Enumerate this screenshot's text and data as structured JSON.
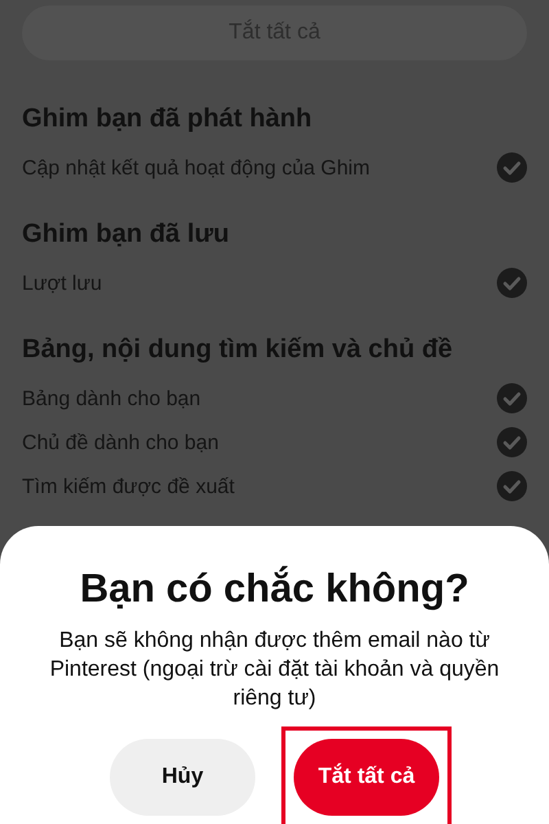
{
  "top_button": {
    "label": "Tắt tất cả"
  },
  "sections": [
    {
      "title": "Ghim bạn đã phát hành",
      "items": [
        {
          "label": "Cập nhật kết quả hoạt động của Ghim",
          "checked": true
        }
      ]
    },
    {
      "title": "Ghim bạn đã lưu",
      "items": [
        {
          "label": "Lượt lưu",
          "checked": true
        }
      ]
    },
    {
      "title": "Bảng, nội dung tìm kiếm và chủ đề",
      "items": [
        {
          "label": "Bảng dành cho bạn",
          "checked": true
        },
        {
          "label": "Chủ đề dành cho bạn",
          "checked": true
        },
        {
          "label": "Tìm kiếm được đề xuất",
          "checked": true
        }
      ]
    }
  ],
  "dialog": {
    "title": "Bạn có chắc không?",
    "message": "Bạn sẽ không nhận được thêm email nào từ Pinterest (ngoại trừ cài đặt tài khoản và quyền riêng tư)",
    "buttons": [
      {
        "label": "Hủy",
        "kind": "secondary",
        "highlighted": false
      },
      {
        "label": "Tắt tất cả",
        "kind": "primary",
        "highlighted": true
      }
    ]
  }
}
